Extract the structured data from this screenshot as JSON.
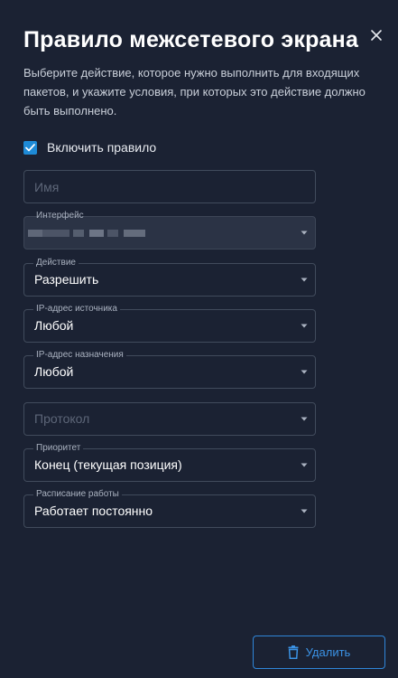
{
  "dialog": {
    "title": "Правило межсетевого экрана",
    "description": "Выберите действие, которое нужно выполнить для входящих пакетов, и укажите условия, при которых это действие должно быть выполнено.",
    "close_icon": "close-icon"
  },
  "enable_rule": {
    "label": "Включить правило",
    "checked": true,
    "accent_color": "#1e8ad6"
  },
  "fields": {
    "name": {
      "placeholder": "Имя",
      "value": ""
    },
    "interface": {
      "label": "Интерфейс",
      "value": ""
    },
    "action": {
      "label": "Действие",
      "value": "Разрешить"
    },
    "source_ip": {
      "label": "IP-адрес источника",
      "value": "Любой"
    },
    "destination_ip": {
      "label": "IP-адрес назначения",
      "value": "Любой"
    },
    "protocol": {
      "placeholder": "Протокол",
      "value": ""
    },
    "priority": {
      "label": "Приоритет",
      "value": "Конец (текущая позиция)"
    },
    "schedule": {
      "label": "Расписание работы",
      "value": "Работает постоянно"
    }
  },
  "footer": {
    "delete_label": "Удалить",
    "delete_icon": "trash-icon",
    "accent_color": "#2f86d9"
  }
}
